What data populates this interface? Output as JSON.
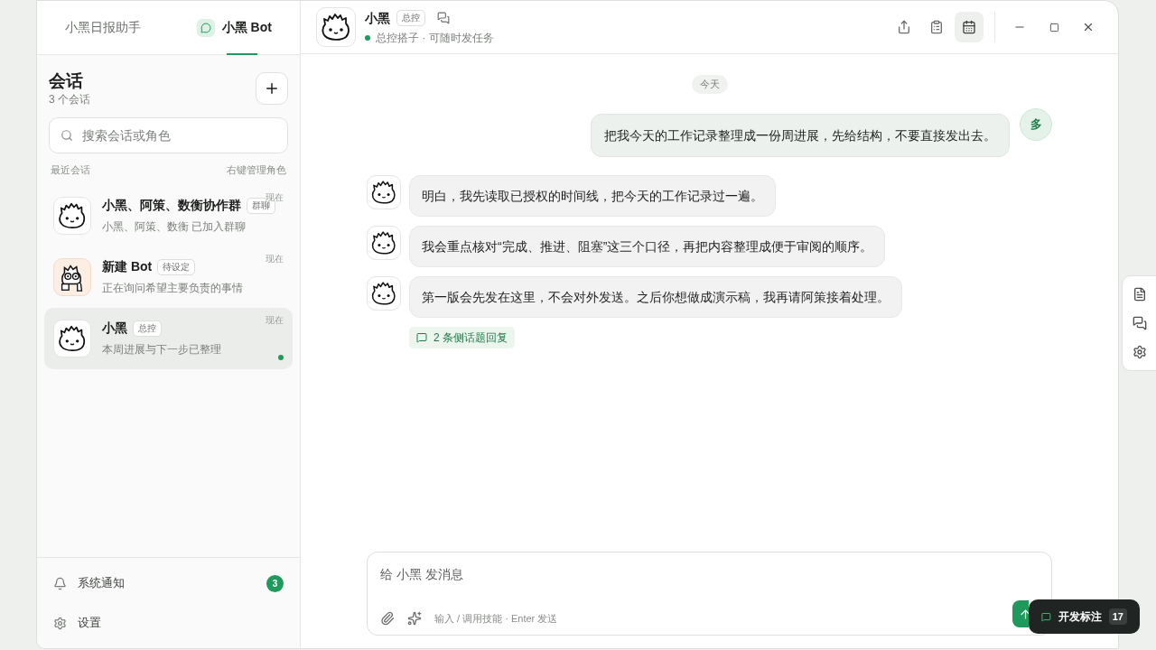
{
  "app_tabs": [
    {
      "label": "小黑日报助手",
      "selected": false
    },
    {
      "label": "小黑 Bot",
      "selected": true
    }
  ],
  "sidebar": {
    "title": "会话",
    "count": "3 个会话",
    "search": {
      "placeholder": "搜索会话或角色"
    },
    "section_label": "最近会话",
    "section_hint": "右键管理角色",
    "conversations": [
      {
        "kind": "cat",
        "title": "小黑、阿策、数衡协作群",
        "tag": "群聊",
        "subtitle": "小黑、阿策、数衡 已加入群聊",
        "time": "现在",
        "selected": false,
        "unread": false
      },
      {
        "kind": "bot",
        "title": "新建 Bot",
        "tag": "待设定",
        "subtitle": "正在询问希望主要负责的事情",
        "time": "现在",
        "selected": false,
        "unread": false
      },
      {
        "kind": "cat",
        "title": "小黑",
        "tag": "总控",
        "subtitle": "本周进展与下一步已整理",
        "time": "现在",
        "selected": true,
        "unread": true
      }
    ],
    "footer": [
      {
        "kind": "notifications",
        "label": "系统通知",
        "badge": "3"
      },
      {
        "kind": "settings",
        "label": "设置"
      }
    ]
  },
  "chat_header": {
    "name": "小黑",
    "tag": "总控",
    "online": true,
    "status": "总控搭子 · 可随时发任务"
  },
  "toolbar": [
    {
      "kind": "share",
      "selected": false
    },
    {
      "kind": "tasks",
      "selected": false
    },
    {
      "kind": "calendar",
      "selected": true
    }
  ],
  "date_divider": "今天",
  "messages": [
    {
      "kind": "user",
      "avatar": "多",
      "text": "把我今天的工作记录整理成一份周进展，先给结构，不要直接发出去。"
    },
    {
      "kind": "bot",
      "text": "明白，我先读取已授权的时间线，把今天的工作记录过一遍。"
    },
    {
      "kind": "bot",
      "text": "我会重点核对“完成、推进、阻塞”这三个口径，再把内容整理成便于审阅的顺序。"
    },
    {
      "kind": "bot",
      "text": "第一版会先发在这里，不会对外发送。之后你想做成演示稿，我再请阿策接着处理。",
      "replies": "2 条侧话题回复"
    }
  ],
  "composer": {
    "placeholder": "给 小黑 发消息",
    "hint": "输入 / 调用技能 · Enter 发送"
  },
  "side_rail": [
    {
      "kind": "notes"
    },
    {
      "kind": "chat"
    },
    {
      "kind": "settings"
    }
  ],
  "dev_badge": {
    "label": "开发标注",
    "count": "17"
  }
}
